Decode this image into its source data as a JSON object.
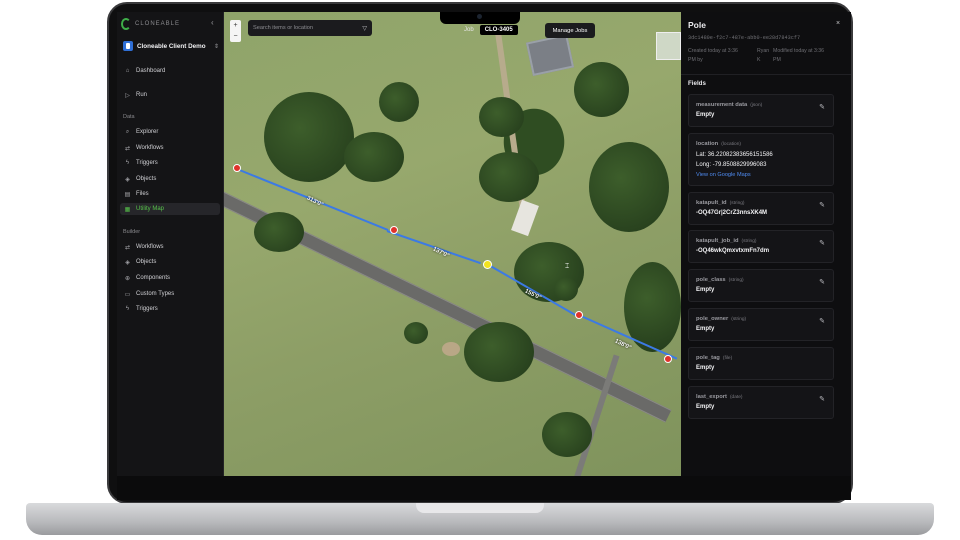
{
  "sidebar": {
    "brand": "CLONEABLE",
    "collapse_glyph": "‹",
    "workspace": "Cloneable Client Demo",
    "workspace_caret": "⇕",
    "top_items": [
      {
        "label": "Dashboard",
        "icon": "home-icon"
      },
      {
        "label": "Run",
        "icon": "play-icon"
      }
    ],
    "data_section": "Data",
    "data_items": [
      {
        "label": "Explorer",
        "icon": "search-icon"
      },
      {
        "label": "Workflows",
        "icon": "workflow-icon"
      },
      {
        "label": "Triggers",
        "icon": "lightning-icon"
      },
      {
        "label": "Objects",
        "icon": "cube-icon"
      },
      {
        "label": "Files",
        "icon": "file-icon"
      },
      {
        "label": "Utility Map",
        "icon": "map-icon",
        "active": true
      }
    ],
    "builder_section": "Builder",
    "builder_items": [
      {
        "label": "Workflows",
        "icon": "workflow-icon"
      },
      {
        "label": "Objects",
        "icon": "cube-icon"
      },
      {
        "label": "Components",
        "icon": "component-icon"
      },
      {
        "label": "Custom Types",
        "icon": "type-icon"
      },
      {
        "label": "Triggers",
        "icon": "lightning-icon"
      }
    ]
  },
  "map": {
    "search_placeholder": "Search items or location",
    "job_label": "Job",
    "job_id": "CLO-3405",
    "manage_jobs": "Manage Jobs",
    "zoom_in": "+",
    "zoom_out": "−",
    "span_labels": [
      "313'0\"",
      "137'0\"",
      "155'0\"",
      "138'0\""
    ]
  },
  "panel": {
    "title": "Pole",
    "close": "×",
    "id": "3dc1480e-f2c7-487e-abb0-ee28d7843cf7",
    "created": [
      "Created today at 3:36",
      "PM by"
    ],
    "author": [
      "Ryan",
      "K"
    ],
    "modified": [
      "Modified today at 3:36",
      "PM"
    ],
    "fields_heading": "Fields",
    "fields": [
      {
        "name": "measurement data",
        "type": "(json)",
        "value": "Empty",
        "editable": true
      },
      {
        "name": "location",
        "type": "(location)",
        "lat": "Lat: 36.22082383656151586",
        "long": "Long: -79.8508829996083",
        "link": "View on Google Maps",
        "editable": false
      },
      {
        "name": "katapult_id",
        "type": "(string)",
        "value": "-OQ47Gr|2CrZ3nnsXK4M",
        "editable": true
      },
      {
        "name": "katapult_job_id",
        "type": "(string)",
        "value": "-OQ46wkQmxvtxmFn7dm",
        "editable": true
      },
      {
        "name": "pole_class",
        "type": "(string)",
        "value": "Empty",
        "editable": true
      },
      {
        "name": "pole_owner",
        "type": "(string)",
        "value": "Empty",
        "editable": true
      },
      {
        "name": "pole_tag",
        "type": "(file)",
        "value": "Empty",
        "editable": false
      },
      {
        "name": "last_export",
        "type": "(date)",
        "value": "Empty",
        "editable": true
      }
    ]
  },
  "colors": {
    "accent": "#56c24a",
    "span_line": "#3c7ae4",
    "pole": "#e0332b",
    "selected_pole": "#f2e21e",
    "link": "#4f8cf2"
  }
}
